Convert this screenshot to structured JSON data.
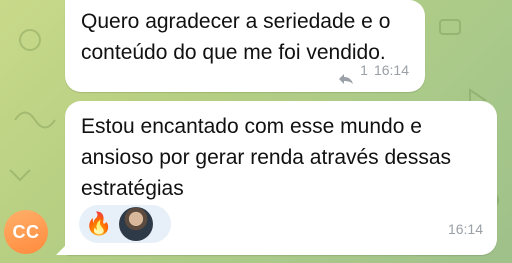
{
  "messages": [
    {
      "text": "Quero agradecer a seriedade e o conteúdo do que me foi vendido.",
      "reply_count": "1",
      "time": "16:14"
    },
    {
      "text": "Estou encantado com esse mundo e ansioso por gerar renda através dessas estratégias",
      "time": "16:14",
      "reactions": [
        "🔥"
      ]
    }
  ],
  "sender": {
    "initials": "CC",
    "avatar_color": "#ff8a3d"
  },
  "colors": {
    "bubble": "#ffffff",
    "meta": "#9aa0a6",
    "reaction_bg": "#e7f0f9"
  }
}
